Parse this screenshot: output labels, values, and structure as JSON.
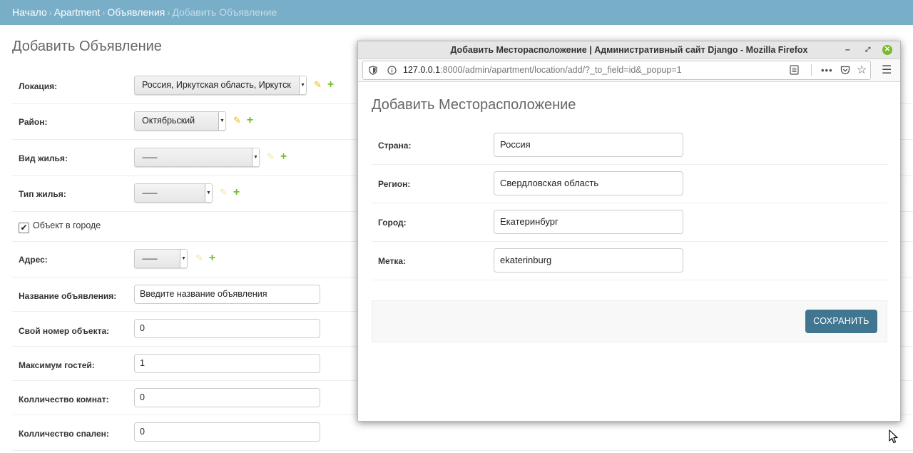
{
  "breadcrumbs": {
    "home": "Начало",
    "app": "Apartment",
    "model": "Объявления",
    "current": "Добавить Объявление",
    "separator": "›"
  },
  "page_title": "Добавить Объявление",
  "form": {
    "location": {
      "label": "Локация:",
      "value": "Россия, Иркутская область, Иркутск"
    },
    "district": {
      "label": "Район:",
      "value": "Октябрьский"
    },
    "housing_kind": {
      "label": "Вид жилья:",
      "value": "---------"
    },
    "housing_type": {
      "label": "Тип жилья:",
      "value": "---------"
    },
    "in_city": {
      "label": "Объект в городе",
      "checked": true
    },
    "address": {
      "label": "Адрес:",
      "value": "---------"
    },
    "title": {
      "label": "Название объявления:",
      "value": "Введите название объявления"
    },
    "own_number": {
      "label": "Свой номер объекта:",
      "value": "0"
    },
    "max_guests": {
      "label": "Максимум гостей:",
      "value": "1"
    },
    "rooms": {
      "label": "Колличество комнат:",
      "value": "0"
    },
    "bedrooms": {
      "label": "Колличество спален:",
      "value": "0"
    }
  },
  "popup": {
    "window_title": "Добавить Месторасположение | Административный сайт Django - Mozilla Firefox",
    "url_host": "127.0.0.1",
    "url_rest": ":8000/admin/apartment/location/add/?_to_field=id&_popup=1",
    "page_title": "Добавить Месторасположение",
    "fields": [
      {
        "label": "Страна:",
        "value": "Россия"
      },
      {
        "label": "Регион:",
        "value": "Свердловская область"
      },
      {
        "label": "Город:",
        "value": "Екатеринбург"
      },
      {
        "label": "Метка:",
        "value": "ekaterinburg"
      }
    ],
    "save_label": "СОХРАНИТЬ"
  },
  "icons": {
    "edit": "pencil-icon",
    "add": "plus-icon",
    "shield": "shield-icon",
    "info": "info-icon",
    "reader": "reader-view-icon",
    "more": "more-icon",
    "pocket": "pocket-icon",
    "bookmark": "star-icon",
    "menu": "hamburger-icon"
  },
  "colors": {
    "breadcrumb_bg": "#79aec8",
    "button_bg": "#417690",
    "add_icon": "#70bf2b",
    "edit_icon": "#efb80b",
    "close_button": "#7ab929"
  }
}
